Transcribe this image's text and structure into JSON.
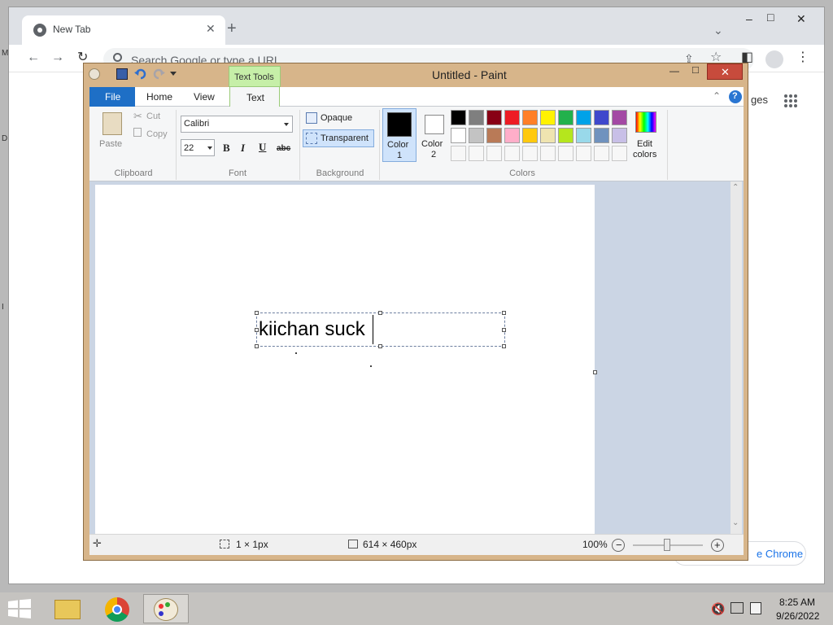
{
  "desktop": {
    "edge_glyphs": [
      "M",
      "D",
      "I"
    ]
  },
  "chrome": {
    "tab": {
      "title": "New Tab"
    },
    "new_tab_symbol": "+",
    "window_controls": {
      "minimize": "–",
      "maximize": "□",
      "close": "✕"
    },
    "tab_list_symbol": "⌄",
    "nav": {
      "back": "←",
      "forward": "→",
      "reload": "↻"
    },
    "omnibox": {
      "placeholder": "Search Google or type a URL"
    },
    "toolbar_icons": {
      "share": "⇪",
      "star": "☆",
      "side_panel": "◧",
      "profile": "●",
      "menu": "⋮"
    },
    "page": {
      "images_link_partial": "ges",
      "apps_icon": "⋮⋮⋮",
      "customize_partial": "e Chrome"
    }
  },
  "paint": {
    "title": "Untitled - Paint",
    "contextual_tab": "Text Tools",
    "tabs": {
      "file": "File",
      "home": "Home",
      "view": "View",
      "text": "Text"
    },
    "window_controls": {
      "minimize": "—",
      "maximize": "□",
      "close": "✕"
    },
    "help": "?",
    "collapse": "⌃",
    "clipboard": {
      "paste": "Paste",
      "cut": "Cut",
      "copy": "Copy",
      "title": "Clipboard"
    },
    "font": {
      "family": "Calibri",
      "size": "22",
      "bold": "B",
      "italic": "I",
      "underline": "U",
      "strike": "abc",
      "title": "Font"
    },
    "background": {
      "opaque": "Opaque",
      "transparent": "Transparent",
      "title": "Background"
    },
    "colors": {
      "color1_label": [
        "Color",
        "1"
      ],
      "color2_label": [
        "Color",
        "2"
      ],
      "color1": "#000000",
      "color2": "#ffffff",
      "title": "Colors",
      "edit_label": [
        "Edit",
        "colors"
      ],
      "palette_row1": [
        "#000000",
        "#7f7f7f",
        "#880015",
        "#ed1c24",
        "#ff7f27",
        "#fff200",
        "#22b14c",
        "#00a2e8",
        "#3f48cc",
        "#a349a4"
      ],
      "palette_row2": [
        "#ffffff",
        "#c3c3c3",
        "#b97a57",
        "#ffaec9",
        "#ffc90e",
        "#efe4b0",
        "#b5e61d",
        "#99d9ea",
        "#7092be",
        "#c8bfe7"
      ]
    },
    "canvas": {
      "text": "kiichan suck"
    },
    "status": {
      "selection": "1 × 1px",
      "size": "614 × 460px",
      "zoom": "100%",
      "zoom_out": "−",
      "zoom_in": "+"
    }
  },
  "taskbar": {
    "time": "8:25 AM",
    "date": "9/26/2022"
  }
}
